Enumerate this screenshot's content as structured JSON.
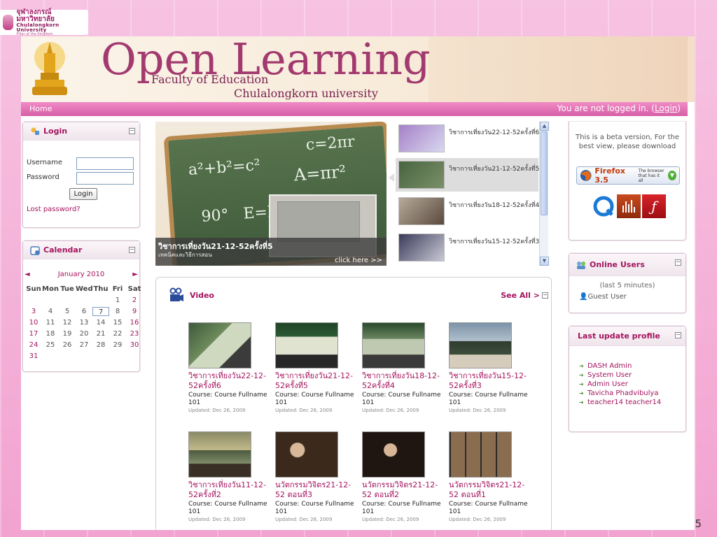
{
  "slide": {
    "university_logo_th": "จุฬาลงกรณ์มหาวิทยาลัย",
    "university_logo_en": "Chulalongkorn University",
    "university_logo_motto": "Pillar of the Kingdom",
    "page_number": "5"
  },
  "banner": {
    "title": "Open Learning",
    "faculty": "Faculty of Education",
    "university": "Chulalongkorn university"
  },
  "nav": {
    "home": "Home",
    "login_status_prefix": "You are not logged in. (",
    "login_link": "Login",
    "login_status_suffix": ")"
  },
  "login_block": {
    "title": "Login",
    "username_label": "Username",
    "password_label": "Password",
    "button": "Login",
    "lost_password": "Lost password?"
  },
  "calendar": {
    "title": "Calendar",
    "month": "January 2010",
    "prev": "◄",
    "next": "►",
    "days": [
      "Sun",
      "Mon",
      "Tue",
      "Wed",
      "Thu",
      "Fri",
      "Sat"
    ],
    "dates": [
      "",
      "",
      "",
      "",
      "",
      "1",
      "2",
      "3",
      "4",
      "5",
      "6",
      "7",
      "8",
      "9",
      "10",
      "11",
      "12",
      "13",
      "14",
      "15",
      "16",
      "17",
      "18",
      "19",
      "20",
      "21",
      "22",
      "23",
      "24",
      "25",
      "26",
      "27",
      "28",
      "29",
      "30",
      "31",
      "",
      "",
      "",
      "",
      "",
      ""
    ],
    "today": "7"
  },
  "featured": {
    "title": "วิชาการเที่ยงวัน21-12-52ครั้งที่5",
    "subtitle": "เทคนิคและวิธีการสอน",
    "click": "click here >>",
    "chalk": [
      "a²+b²=c²",
      "c=2πr",
      "A=πr²",
      "90°",
      "E=M"
    ]
  },
  "playlist": [
    {
      "label": "วิชาการเที่ยงวัน22-12-52ครั้งที่6"
    },
    {
      "label": "วิชาการเที่ยงวัน21-12-52ครั้งที่5"
    },
    {
      "label": "วิชาการเที่ยงวัน18-12-52ครั้งที่4"
    },
    {
      "label": "วิชาการเที่ยงวัน15-12-52ครั้งที่3"
    }
  ],
  "video_block": {
    "title": "Video",
    "see_all": "See All >"
  },
  "videos": [
    {
      "title": "วิชาการเที่ยงวัน22-12-52ครั้งที่6",
      "course": "Course: Course Fullname 101",
      "updated": "Updated: Dec 26, 2009"
    },
    {
      "title": "วิชาการเที่ยงวัน21-12-52ครั้งที่5",
      "course": "Course: Course Fullname 101",
      "updated": "Updated: Dec 26, 2009"
    },
    {
      "title": "วิชาการเที่ยงวัน18-12-52ครั้งที่4",
      "course": "Course: Course Fullname 101",
      "updated": "Updated: Dec 26, 2009"
    },
    {
      "title": "วิชาการเที่ยงวัน15-12-52ครั้งที่3",
      "course": "Course: Course Fullname 101",
      "updated": "Updated: Dec 26, 2009"
    },
    {
      "title": "วิชาการเที่ยงวัน11-12-52ครั้งที่2",
      "course": "Course: Course Fullname 101",
      "updated": "Updated: Dec 26, 2009"
    },
    {
      "title": "นวัตกรรมวิจิตร21-12-52 ตอนที่3",
      "course": "Course: Course Fullname 101",
      "updated": "Updated: Dec 26, 2009"
    },
    {
      "title": "นวัตกรรมวิจิตร21-12-52 ตอนที่2",
      "course": "Course: Course Fullname 101",
      "updated": "Updated: Dec 26, 2009"
    },
    {
      "title": "นวัตกรรมวิจิตร21-12-52 ตอนที่1",
      "course": "Course: Course Fullname 101",
      "updated": "Updated: Dec 26, 2009"
    }
  ],
  "beta_block": {
    "text": "This is a beta version, For the best view, please download",
    "firefox": "Firefox 3.5",
    "firefox_tag": "The browser that has it all"
  },
  "online_users": {
    "title": "Online Users",
    "window": "(last 5 minutes)",
    "user": "Guest User"
  },
  "last_update": {
    "title": "Last update profile",
    "users": [
      "DASH Admin",
      "System User",
      "Admin User",
      "Tavicha Phadvibulya",
      "teacher14 teacher14"
    ]
  },
  "colors": {
    "accent": "#a5145e",
    "navbar": "#e67bb9",
    "slide_bg": "#f3a9d3"
  }
}
